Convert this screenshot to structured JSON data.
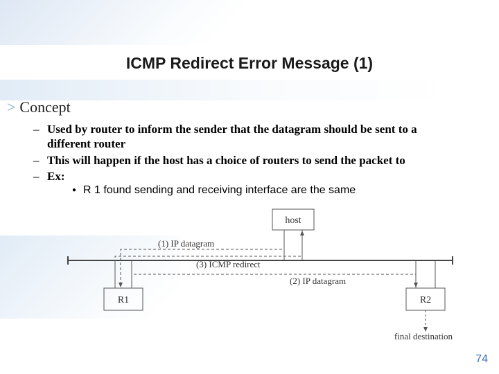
{
  "title": "ICMP Redirect Error Message (1)",
  "concept_heading": "Concept",
  "bullets": [
    "Used by router to inform the sender that the datagram should be sent to a different router",
    "This will happen if the host has a choice of routers to send the packet to",
    "Ex:"
  ],
  "sub_bullet": "R 1 found sending and receiving interface are the same",
  "diagram": {
    "host_label": "host",
    "r1_label": "R1",
    "r2_label": "R2",
    "final_dest_label": "final destination",
    "arrow1": "(1) IP datagram",
    "arrow2": "(2) IP datagram",
    "arrow3": "(3) ICMP redirect"
  },
  "page_number": "74"
}
